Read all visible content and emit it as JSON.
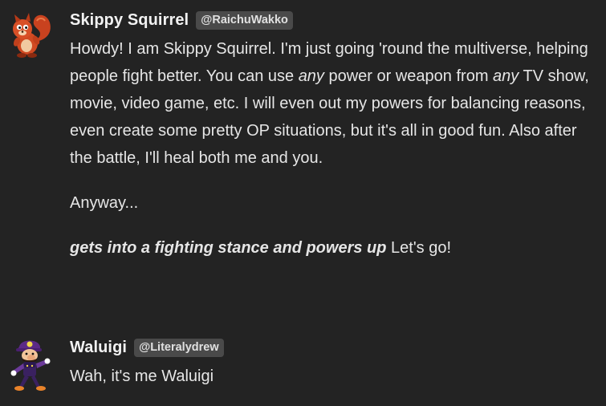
{
  "messages": [
    {
      "username": "Skippy Squirrel",
      "handle": "@RaichuWakko",
      "avatar_icon": "red-squirrel-avatar-icon",
      "p1": {
        "t1": "Howdy! I am Skippy Squirrel. I'm just going 'round the multiverse, helping people fight better. You can use ",
        "em1": "any",
        "t2": " power or weapon from ",
        "em2": "any",
        "t3": " TV show, movie, video game, etc. I will even out my powers for balancing reasons, even create some pretty OP situations, but it's all in good fun. Also after the battle, I'll heal both me and you."
      },
      "p2": "Anyway...",
      "p3": {
        "action": "gets into a fighting stance and powers up",
        "text": " Let's go!"
      }
    },
    {
      "username": "Waluigi",
      "handle": "@Literalydrew",
      "avatar_icon": "waluigi-avatar-icon",
      "text": "Wah, it's me Waluigi"
    }
  ]
}
